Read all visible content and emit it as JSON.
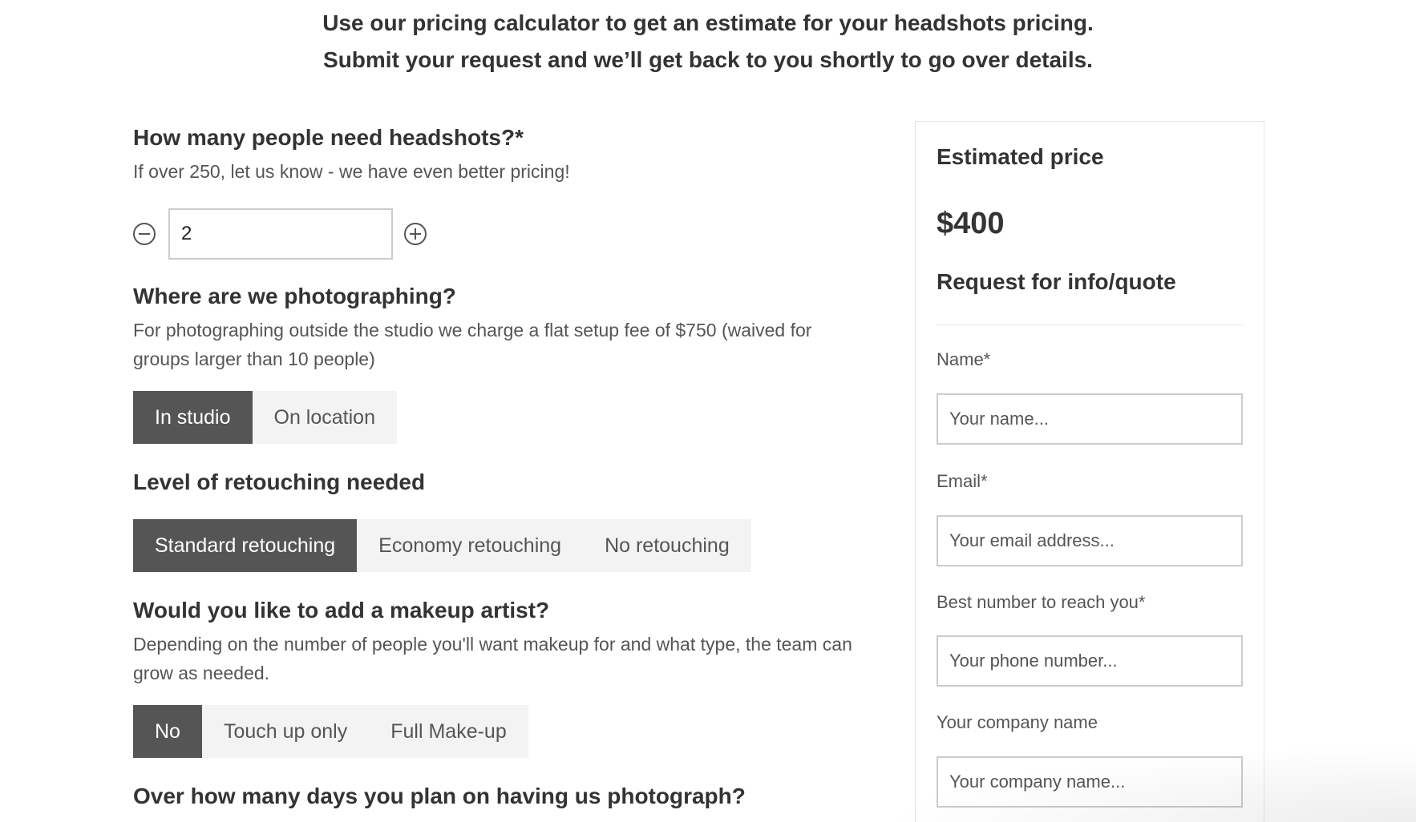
{
  "intro": {
    "line1": "Use our pricing calculator to get an estimate for your headshots pricing.",
    "line2": "Submit your request and we’ll get back to you shortly to go over details."
  },
  "people": {
    "title": "How many people need headshots?*",
    "description": "If over 250, let us know - we have even better pricing!",
    "value": "2",
    "decrement_icon": "minus-circle-icon",
    "increment_icon": "plus-circle-icon"
  },
  "location": {
    "title": "Where are we photographing?",
    "description": "For photographing outside the studio we charge a flat setup fee of $750 (waived for groups larger than 10 people)",
    "options": [
      "In studio",
      "On location"
    ],
    "selected": "In studio"
  },
  "retouching": {
    "title": "Level of retouching needed",
    "options": [
      "Standard retouching",
      "Economy retouching",
      "No retouching"
    ],
    "selected": "Standard retouching"
  },
  "makeup": {
    "title": "Would you like to add a makeup artist?",
    "description": "Depending on the number of people you'll want makeup for and what type, the team can grow as needed.",
    "options": [
      "No",
      "Touch up only",
      "Full Make-up"
    ],
    "selected": "No"
  },
  "days": {
    "title": "Over how many days you plan on having us photograph?"
  },
  "quote": {
    "estimate_label": "Estimated price",
    "price": "$400",
    "request_heading": "Request for info/quote",
    "fields": {
      "name": {
        "label": "Name*",
        "placeholder": "Your name..."
      },
      "email": {
        "label": "Email*",
        "placeholder": "Your email address..."
      },
      "phone": {
        "label": "Best number to reach you*",
        "placeholder": "Your phone number..."
      },
      "company": {
        "label": "Your company name",
        "placeholder": "Your company name..."
      }
    }
  },
  "colors": {
    "active_segment": "#555555",
    "inactive_segment": "#f3f3f3",
    "text": "#333333"
  }
}
